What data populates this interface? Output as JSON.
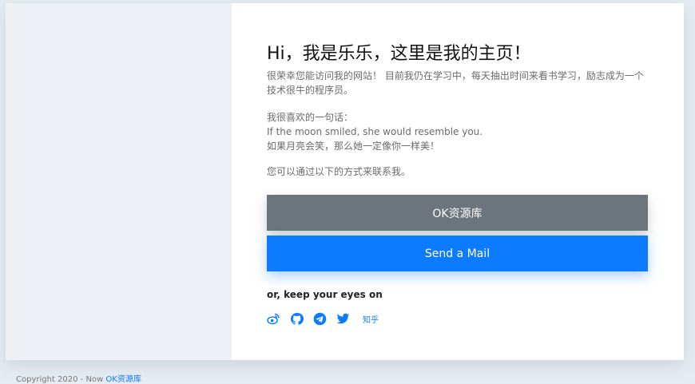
{
  "main": {
    "title": "Hi，我是乐乐，这里是我的主页！",
    "intro": "很荣幸您能访问我的网站！ 目前我仍在学习中，每天抽出时间来看书学习，励志成为一个技术很牛的程序员。",
    "quote_intro": "我很喜欢的一句话：",
    "quote_en": "If the moon smiled, she would resemble you.",
    "quote_cn": "如果月亮会笑，那么她一定像你一样美！",
    "contact": "您可以通过以下的方式来联系我。"
  },
  "buttons": {
    "site": "OK资源库",
    "mail": "Send a Mail"
  },
  "social": {
    "heading": "or, keep your eyes on",
    "icons": [
      "weibo-icon",
      "github-icon",
      "telegram-icon",
      "twitter-icon"
    ],
    "zhihu_label": "知乎"
  },
  "footer": {
    "prefix": "Copyright 2020 - Now",
    "link": "OK资源库"
  },
  "colors": {
    "accent": "#0d7bff",
    "gray_button": "#6c757d",
    "page_bg": "#e6ecf2",
    "left_panel": "#edf1f5"
  }
}
